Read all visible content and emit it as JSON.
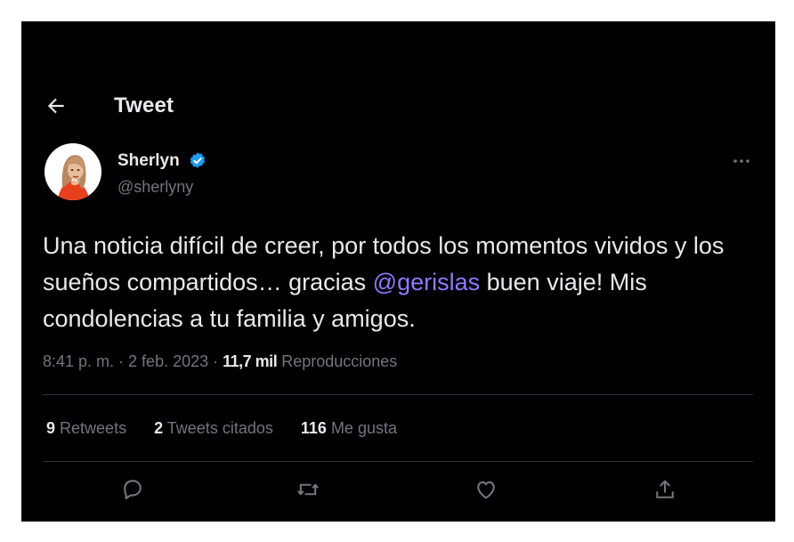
{
  "header": {
    "title": "Tweet",
    "back_icon": "back-arrow-icon"
  },
  "author": {
    "display_name": "Sherlyn",
    "handle": "@sherlyny",
    "verified": true
  },
  "tweet": {
    "text_before_mention": "Una noticia difícil de creer, por todos los momentos vividos y los sueños compartidos… gracias ",
    "mention": "@gerislas",
    "text_after_mention": " buen viaje! Mis condolencias a tu familia y amigos."
  },
  "meta": {
    "time": "8:41 p. m.",
    "separator": " · ",
    "date": "2 feb. 2023",
    "views_count": "11,7 mil",
    "views_label": "Reproducciones"
  },
  "stats": {
    "retweets_count": "9",
    "retweets_label": "Retweets",
    "quotes_count": "2",
    "quotes_label": "Tweets citados",
    "likes_count": "116",
    "likes_label": "Me gusta"
  },
  "actions": [
    "reply-icon",
    "retweet-icon",
    "like-icon",
    "share-icon"
  ],
  "colors": {
    "background": "#000000",
    "text": "#e7e9ea",
    "muted": "#71767b",
    "link": "#8f79ff",
    "verified": "#1d9bf0"
  }
}
